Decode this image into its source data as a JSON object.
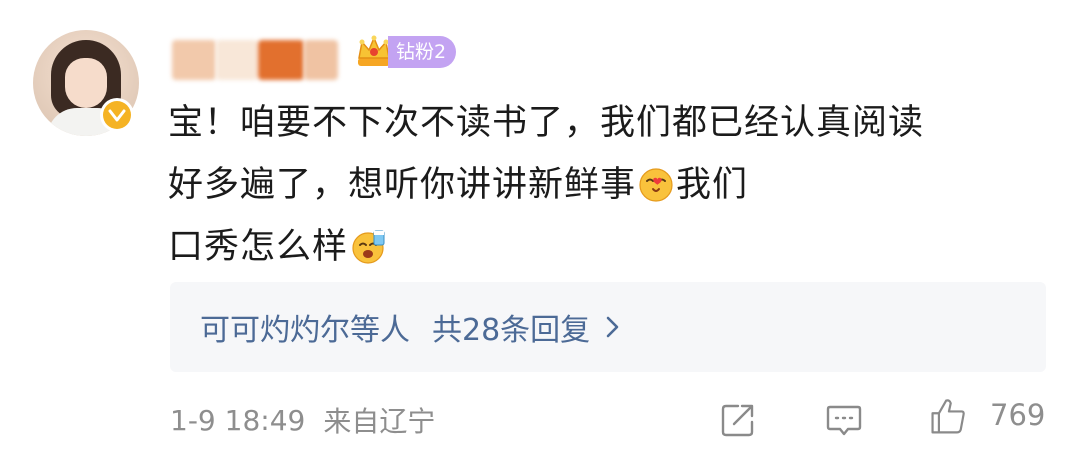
{
  "user": {
    "badge": "钻粉2",
    "name_redacted": true,
    "verified_icon": "verified-icon",
    "crown_icon": "crown-icon"
  },
  "comment": {
    "line1": "宝！咱要不下次不读书了，我们都已经认真阅读",
    "line2_text": "好多遍了，想听你讲讲新鲜事",
    "line2_after_emoji": "我们",
    "line3_text": "口秀怎么样",
    "emoji1": "kiss-heart-emoji",
    "emoji2": "cheers-emoji"
  },
  "replies": {
    "users": "可可灼灼尔等人",
    "count_text": "共28条回复",
    "chevron_icon": "chevron-right-icon"
  },
  "footer": {
    "time": "1-9 18:49",
    "location": "来自辽宁",
    "like_count": "769",
    "share_icon": "share-icon",
    "comment_icon": "comment-icon",
    "like_icon": "thumbs-up-icon"
  },
  "colors": {
    "link_blue": "#4c6a96",
    "badge_purple": "#c3a3f2",
    "verified_gold": "#f5b324",
    "meta_gray": "#8e8e8e"
  }
}
